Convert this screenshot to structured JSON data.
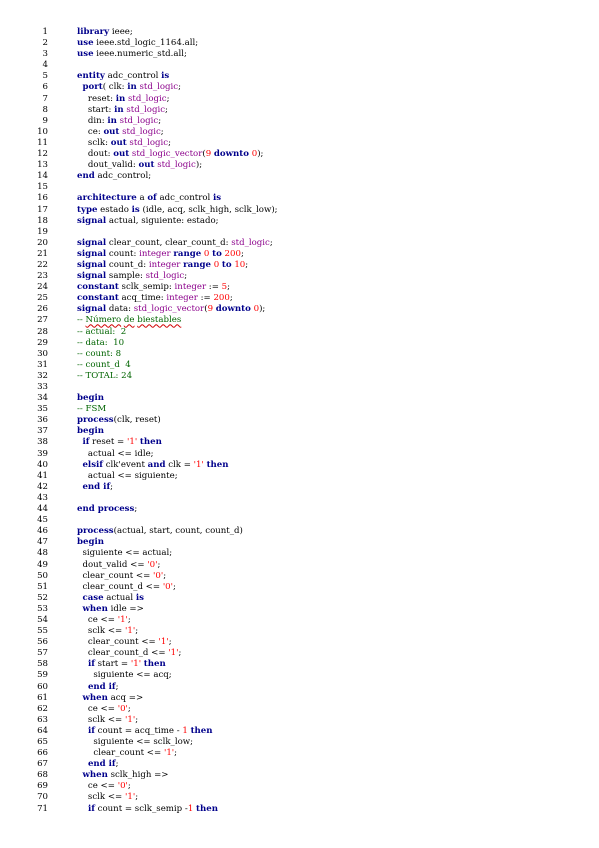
{
  "colors": {
    "keyword": "#00008b",
    "type": "#8b008b",
    "number": "#ff0000",
    "comment": "#006400",
    "text": "#000000"
  },
  "lines": [
    {
      "n": "1",
      "tokens": [
        {
          "t": "library",
          "c": "kw"
        },
        {
          "t": " ieee;"
        }
      ]
    },
    {
      "n": "2",
      "tokens": [
        {
          "t": "use",
          "c": "kw"
        },
        {
          "t": " ieee.std_logic_1164.all;"
        }
      ]
    },
    {
      "n": "3",
      "tokens": [
        {
          "t": "use",
          "c": "kw"
        },
        {
          "t": " ieee.numeric_std.all;"
        }
      ]
    },
    {
      "n": "4",
      "tokens": []
    },
    {
      "n": "5",
      "tokens": [
        {
          "t": "entity",
          "c": "kw"
        },
        {
          "t": " adc_control "
        },
        {
          "t": "is",
          "c": "kw"
        }
      ]
    },
    {
      "n": "6",
      "tokens": [
        {
          "t": "  "
        },
        {
          "t": "port",
          "c": "kw"
        },
        {
          "t": "( clk: "
        },
        {
          "t": "in",
          "c": "kw"
        },
        {
          "t": " "
        },
        {
          "t": "std_logic",
          "c": "ty"
        },
        {
          "t": ";"
        }
      ]
    },
    {
      "n": "7",
      "tokens": [
        {
          "t": "    reset: "
        },
        {
          "t": "in",
          "c": "kw"
        },
        {
          "t": " "
        },
        {
          "t": "std_logic",
          "c": "ty"
        },
        {
          "t": ";"
        }
      ]
    },
    {
      "n": "8",
      "tokens": [
        {
          "t": "    start: "
        },
        {
          "t": "in",
          "c": "kw"
        },
        {
          "t": " "
        },
        {
          "t": "std_logic",
          "c": "ty"
        },
        {
          "t": ";"
        }
      ]
    },
    {
      "n": "9",
      "tokens": [
        {
          "t": "    din: "
        },
        {
          "t": "in",
          "c": "kw"
        },
        {
          "t": " "
        },
        {
          "t": "std_logic",
          "c": "ty"
        },
        {
          "t": ";"
        }
      ]
    },
    {
      "n": "10",
      "tokens": [
        {
          "t": "    ce: "
        },
        {
          "t": "out",
          "c": "kw"
        },
        {
          "t": " "
        },
        {
          "t": "std_logic",
          "c": "ty"
        },
        {
          "t": ";"
        }
      ]
    },
    {
      "n": "11",
      "tokens": [
        {
          "t": "    sclk: "
        },
        {
          "t": "out",
          "c": "kw"
        },
        {
          "t": " "
        },
        {
          "t": "std_logic",
          "c": "ty"
        },
        {
          "t": ";"
        }
      ]
    },
    {
      "n": "12",
      "tokens": [
        {
          "t": "    dout: "
        },
        {
          "t": "out",
          "c": "kw"
        },
        {
          "t": " "
        },
        {
          "t": "std_logic_vector",
          "c": "ty"
        },
        {
          "t": "("
        },
        {
          "t": "9",
          "c": "nm"
        },
        {
          "t": " "
        },
        {
          "t": "downto",
          "c": "kw"
        },
        {
          "t": " "
        },
        {
          "t": "0",
          "c": "nm"
        },
        {
          "t": ");"
        }
      ]
    },
    {
      "n": "13",
      "tokens": [
        {
          "t": "    dout_valid: "
        },
        {
          "t": "out",
          "c": "kw"
        },
        {
          "t": " "
        },
        {
          "t": "std_logic",
          "c": "ty"
        },
        {
          "t": ");"
        }
      ]
    },
    {
      "n": "14",
      "tokens": [
        {
          "t": "end",
          "c": "kw"
        },
        {
          "t": " adc_control;"
        }
      ]
    },
    {
      "n": "15",
      "tokens": []
    },
    {
      "n": "16",
      "tokens": [
        {
          "t": "architecture",
          "c": "kw"
        },
        {
          "t": " a "
        },
        {
          "t": "of",
          "c": "kw"
        },
        {
          "t": " adc_control "
        },
        {
          "t": "is",
          "c": "kw"
        }
      ]
    },
    {
      "n": "17",
      "tokens": [
        {
          "t": "type",
          "c": "kw"
        },
        {
          "t": " estado "
        },
        {
          "t": "is",
          "c": "kw"
        },
        {
          "t": " (idle, acq, sclk_high, sclk_low);"
        }
      ]
    },
    {
      "n": "18",
      "tokens": [
        {
          "t": "signal",
          "c": "kw"
        },
        {
          "t": " actual, siguiente: estado;"
        }
      ]
    },
    {
      "n": "19",
      "tokens": []
    },
    {
      "n": "20",
      "tokens": [
        {
          "t": "signal",
          "c": "kw"
        },
        {
          "t": " clear_count, clear_count_d: "
        },
        {
          "t": "std_logic",
          "c": "ty"
        },
        {
          "t": ";"
        }
      ]
    },
    {
      "n": "21",
      "tokens": [
        {
          "t": "signal",
          "c": "kw"
        },
        {
          "t": " count: "
        },
        {
          "t": "integer",
          "c": "ty"
        },
        {
          "t": " "
        },
        {
          "t": "range",
          "c": "kw"
        },
        {
          "t": " "
        },
        {
          "t": "0",
          "c": "nm"
        },
        {
          "t": " "
        },
        {
          "t": "to",
          "c": "kw"
        },
        {
          "t": " "
        },
        {
          "t": "200",
          "c": "nm"
        },
        {
          "t": ";"
        }
      ]
    },
    {
      "n": "22",
      "tokens": [
        {
          "t": "signal",
          "c": "kw"
        },
        {
          "t": " count_d: "
        },
        {
          "t": "integer",
          "c": "ty"
        },
        {
          "t": " "
        },
        {
          "t": "range",
          "c": "kw"
        },
        {
          "t": " "
        },
        {
          "t": "0",
          "c": "nm"
        },
        {
          "t": " "
        },
        {
          "t": "to",
          "c": "kw"
        },
        {
          "t": " "
        },
        {
          "t": "10",
          "c": "nm"
        },
        {
          "t": ";"
        }
      ]
    },
    {
      "n": "23",
      "tokens": [
        {
          "t": "signal",
          "c": "kw"
        },
        {
          "t": " sample: "
        },
        {
          "t": "std_logic",
          "c": "ty"
        },
        {
          "t": ";"
        }
      ]
    },
    {
      "n": "24",
      "tokens": [
        {
          "t": "constant",
          "c": "kw"
        },
        {
          "t": " sclk_semip: "
        },
        {
          "t": "integer",
          "c": "ty"
        },
        {
          "t": " := "
        },
        {
          "t": "5",
          "c": "nm"
        },
        {
          "t": ";"
        }
      ]
    },
    {
      "n": "25",
      "tokens": [
        {
          "t": "constant",
          "c": "kw"
        },
        {
          "t": " acq_time: "
        },
        {
          "t": "integer",
          "c": "ty"
        },
        {
          "t": " := "
        },
        {
          "t": "200",
          "c": "nm"
        },
        {
          "t": ";"
        }
      ]
    },
    {
      "n": "26",
      "tokens": [
        {
          "t": "signal",
          "c": "kw"
        },
        {
          "t": " data: "
        },
        {
          "t": "std_logic_vector",
          "c": "ty"
        },
        {
          "t": "("
        },
        {
          "t": "9",
          "c": "nm"
        },
        {
          "t": " "
        },
        {
          "t": "downto",
          "c": "kw"
        },
        {
          "t": " "
        },
        {
          "t": "0",
          "c": "nm"
        },
        {
          "t": ");"
        }
      ]
    },
    {
      "n": "27",
      "tokens": [
        {
          "t": "-- ",
          "c": "cm"
        },
        {
          "t": "Número",
          "c": "cm sq"
        },
        {
          "t": " ",
          "c": "cm"
        },
        {
          "t": "de",
          "c": "cm sq"
        },
        {
          "t": " ",
          "c": "cm"
        },
        {
          "t": "biestables",
          "c": "cm sq"
        }
      ]
    },
    {
      "n": "28",
      "tokens": [
        {
          "t": "-- actual:  2",
          "c": "cm"
        }
      ]
    },
    {
      "n": "29",
      "tokens": [
        {
          "t": "-- data:  10",
          "c": "cm"
        }
      ]
    },
    {
      "n": "30",
      "tokens": [
        {
          "t": "-- count: 8",
          "c": "cm"
        }
      ]
    },
    {
      "n": "31",
      "tokens": [
        {
          "t": "-- count_d  4",
          "c": "cm"
        }
      ]
    },
    {
      "n": "32",
      "tokens": [
        {
          "t": "-- TOTAL: 24",
          "c": "cm"
        }
      ]
    },
    {
      "n": "33",
      "tokens": []
    },
    {
      "n": "34",
      "tokens": [
        {
          "t": "begin",
          "c": "kw"
        }
      ]
    },
    {
      "n": "35",
      "tokens": [
        {
          "t": "-- FSM",
          "c": "cm"
        }
      ]
    },
    {
      "n": "36",
      "tokens": [
        {
          "t": "process",
          "c": "kw"
        },
        {
          "t": "(clk, reset)"
        }
      ]
    },
    {
      "n": "37",
      "tokens": [
        {
          "t": "begin",
          "c": "kw"
        }
      ]
    },
    {
      "n": "38",
      "tokens": [
        {
          "t": "  "
        },
        {
          "t": "if",
          "c": "kw"
        },
        {
          "t": " reset = "
        },
        {
          "t": "'1'",
          "c": "st"
        },
        {
          "t": " "
        },
        {
          "t": "then",
          "c": "kw"
        }
      ]
    },
    {
      "n": "39",
      "tokens": [
        {
          "t": "    actual <= idle;"
        }
      ]
    },
    {
      "n": "40",
      "tokens": [
        {
          "t": "  "
        },
        {
          "t": "elsif",
          "c": "kw"
        },
        {
          "t": " clk'event "
        },
        {
          "t": "and",
          "c": "kw"
        },
        {
          "t": " clk = "
        },
        {
          "t": "'1'",
          "c": "st"
        },
        {
          "t": " "
        },
        {
          "t": "then",
          "c": "kw"
        }
      ]
    },
    {
      "n": "41",
      "tokens": [
        {
          "t": "    actual <= siguiente;"
        }
      ]
    },
    {
      "n": "42",
      "tokens": [
        {
          "t": "  "
        },
        {
          "t": "end if",
          "c": "kw"
        },
        {
          "t": ";"
        }
      ]
    },
    {
      "n": "43",
      "tokens": []
    },
    {
      "n": "44",
      "tokens": [
        {
          "t": "end process",
          "c": "kw"
        },
        {
          "t": ";"
        }
      ]
    },
    {
      "n": "45",
      "tokens": []
    },
    {
      "n": "46",
      "tokens": [
        {
          "t": "process",
          "c": "kw"
        },
        {
          "t": "(actual, start, count, count_d)"
        }
      ]
    },
    {
      "n": "47",
      "tokens": [
        {
          "t": "begin",
          "c": "kw"
        }
      ]
    },
    {
      "n": "48",
      "tokens": [
        {
          "t": "  siguiente <= actual;"
        }
      ]
    },
    {
      "n": "49",
      "tokens": [
        {
          "t": "  dout_valid <= "
        },
        {
          "t": "'0'",
          "c": "st"
        },
        {
          "t": ";"
        }
      ]
    },
    {
      "n": "50",
      "tokens": [
        {
          "t": "  clear_count <= "
        },
        {
          "t": "'0'",
          "c": "st"
        },
        {
          "t": ";"
        }
      ]
    },
    {
      "n": "51",
      "tokens": [
        {
          "t": "  clear_count_d <= "
        },
        {
          "t": "'0'",
          "c": "st"
        },
        {
          "t": ";"
        }
      ]
    },
    {
      "n": "52",
      "tokens": [
        {
          "t": "  "
        },
        {
          "t": "case",
          "c": "kw"
        },
        {
          "t": " actual "
        },
        {
          "t": "is",
          "c": "kw"
        }
      ]
    },
    {
      "n": "53",
      "tokens": [
        {
          "t": "  "
        },
        {
          "t": "when",
          "c": "kw"
        },
        {
          "t": " idle =>"
        }
      ]
    },
    {
      "n": "54",
      "tokens": [
        {
          "t": "    ce <= "
        },
        {
          "t": "'1'",
          "c": "st"
        },
        {
          "t": ";"
        }
      ]
    },
    {
      "n": "55",
      "tokens": [
        {
          "t": "    sclk <= "
        },
        {
          "t": "'1'",
          "c": "st"
        },
        {
          "t": ";"
        }
      ]
    },
    {
      "n": "56",
      "tokens": [
        {
          "t": "    clear_count <= "
        },
        {
          "t": "'1'",
          "c": "st"
        },
        {
          "t": ";"
        }
      ]
    },
    {
      "n": "57",
      "tokens": [
        {
          "t": "    clear_count_d <= "
        },
        {
          "t": "'1'",
          "c": "st"
        },
        {
          "t": ";"
        }
      ]
    },
    {
      "n": "58",
      "tokens": [
        {
          "t": "    "
        },
        {
          "t": "if",
          "c": "kw"
        },
        {
          "t": " start = "
        },
        {
          "t": "'1'",
          "c": "st"
        },
        {
          "t": " "
        },
        {
          "t": "then",
          "c": "kw"
        }
      ]
    },
    {
      "n": "59",
      "tokens": [
        {
          "t": "      siguiente <= acq;"
        }
      ]
    },
    {
      "n": "60",
      "tokens": [
        {
          "t": "    "
        },
        {
          "t": "end if",
          "c": "kw"
        },
        {
          "t": ";"
        }
      ]
    },
    {
      "n": "61",
      "tokens": [
        {
          "t": "  "
        },
        {
          "t": "when",
          "c": "kw"
        },
        {
          "t": " acq =>"
        }
      ]
    },
    {
      "n": "62",
      "tokens": [
        {
          "t": "    ce <= "
        },
        {
          "t": "'0'",
          "c": "st"
        },
        {
          "t": ";"
        }
      ]
    },
    {
      "n": "63",
      "tokens": [
        {
          "t": "    sclk <= "
        },
        {
          "t": "'1'",
          "c": "st"
        },
        {
          "t": ";"
        }
      ]
    },
    {
      "n": "64",
      "tokens": [
        {
          "t": "    "
        },
        {
          "t": "if",
          "c": "kw"
        },
        {
          "t": " count = acq_time - "
        },
        {
          "t": "1",
          "c": "nm"
        },
        {
          "t": " "
        },
        {
          "t": "then",
          "c": "kw"
        }
      ]
    },
    {
      "n": "65",
      "tokens": [
        {
          "t": "      siguiente <= sclk_low;"
        }
      ]
    },
    {
      "n": "66",
      "tokens": [
        {
          "t": "      clear_count <= "
        },
        {
          "t": "'1'",
          "c": "st"
        },
        {
          "t": ";"
        }
      ]
    },
    {
      "n": "67",
      "tokens": [
        {
          "t": "    "
        },
        {
          "t": "end if",
          "c": "kw"
        },
        {
          "t": ";"
        }
      ]
    },
    {
      "n": "68",
      "tokens": [
        {
          "t": "  "
        },
        {
          "t": "when",
          "c": "kw"
        },
        {
          "t": " sclk_high =>"
        }
      ]
    },
    {
      "n": "69",
      "tokens": [
        {
          "t": "    ce <= "
        },
        {
          "t": "'0'",
          "c": "st"
        },
        {
          "t": ";"
        }
      ]
    },
    {
      "n": "70",
      "tokens": [
        {
          "t": "    sclk <= "
        },
        {
          "t": "'1'",
          "c": "st"
        },
        {
          "t": ";"
        }
      ]
    },
    {
      "n": "71",
      "tokens": [
        {
          "t": "    "
        },
        {
          "t": "if",
          "c": "kw"
        },
        {
          "t": " count = sclk_semip -"
        },
        {
          "t": "1",
          "c": "nm"
        },
        {
          "t": " "
        },
        {
          "t": "then",
          "c": "kw"
        }
      ]
    }
  ]
}
